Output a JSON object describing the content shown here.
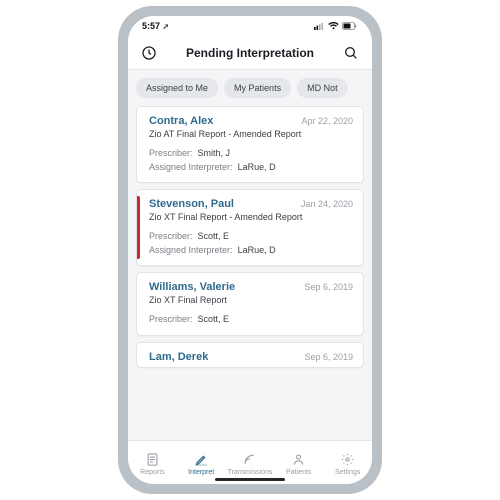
{
  "status": {
    "time": "5:57",
    "loc_arrow": "➚"
  },
  "header": {
    "title": "Pending Interpretation"
  },
  "filters": {
    "chip1": "Assigned to Me",
    "chip2": "My Patients",
    "chip3": "MD Not"
  },
  "cards": [
    {
      "name": "Contra, Alex",
      "date": "Apr 22, 2020",
      "report": "Zio AT Final Report - Amended Report",
      "prescriberLabel": "Prescriber:",
      "prescriber": "Smith, J",
      "interpreterLabel": "Assigned Interpreter:",
      "interpreter": "LaRue, D",
      "flagged": false
    },
    {
      "name": "Stevenson, Paul",
      "date": "Jan 24, 2020",
      "report": "Zio XT Final Report - Amended Report",
      "prescriberLabel": "Prescriber:",
      "prescriber": "Scott, E",
      "interpreterLabel": "Assigned Interpreter:",
      "interpreter": "LaRue, D",
      "flagged": true
    },
    {
      "name": "Williams, Valerie",
      "date": "Sep 6, 2019",
      "report": "Zio XT Final Report",
      "prescriberLabel": "Prescriber:",
      "prescriber": "Scott, E",
      "flagged": false
    },
    {
      "name": "Lam, Derek",
      "date": "Sep 6, 2019",
      "flagged": false
    }
  ],
  "tabs": {
    "reports": "Reports",
    "interpret": "Interpret",
    "transmissions": "Transmissions",
    "patients": "Patients",
    "settings": "Settings"
  }
}
